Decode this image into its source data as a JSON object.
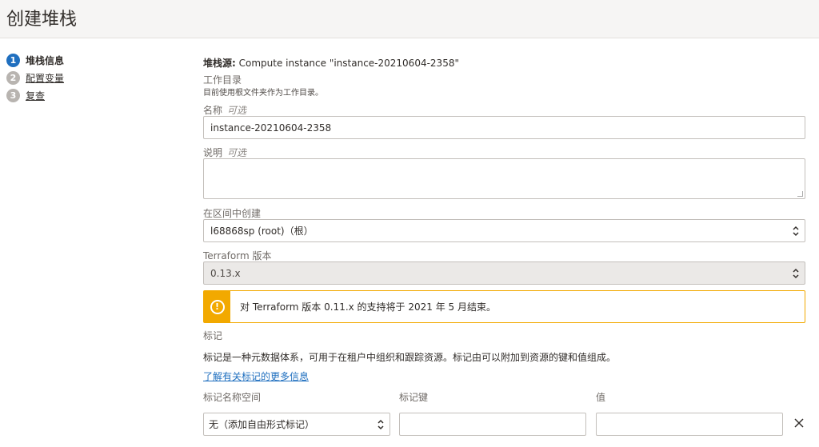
{
  "page": {
    "title": "创建堆栈"
  },
  "steps": [
    {
      "num": "1",
      "label": "堆栈信息",
      "active": true
    },
    {
      "num": "2",
      "label": "配置变量",
      "active": false
    },
    {
      "num": "3",
      "label": "复查",
      "active": false
    }
  ],
  "source": {
    "label": "堆栈源:",
    "value": "Compute instance \"instance-20210604-2358\""
  },
  "workdir": {
    "label": "工作目录",
    "hint": "目前使用根文件夹作为工作目录。"
  },
  "name_field": {
    "label": "名称",
    "optional": "可选",
    "value": "instance-20210604-2358"
  },
  "description_field": {
    "label": "说明",
    "optional": "可选",
    "value": ""
  },
  "compartment_field": {
    "label": "在区间中创建",
    "value": "l68868sp (root)（根）"
  },
  "terraform_field": {
    "label": "Terraform 版本",
    "value": "0.13.x"
  },
  "warning": {
    "icon": "exclamation-icon",
    "text": "对 Terraform 版本 0.11.x 的支持将于 2021 年 5 月结束。",
    "color": "#f2a900"
  },
  "tags": {
    "section_label": "标记",
    "description": "标记是一种元数据体系，可用于在租户中组织和跟踪资源。标记由可以附加到资源的键和值组成。",
    "learn_more": "了解有关标记的更多信息",
    "col_namespace": "标记名称空间",
    "col_key": "标记键",
    "col_value": "值",
    "namespace_value": "无（添加自由形式标记）",
    "key_value": "",
    "value_value": ""
  },
  "colors": {
    "accent": "#1f6fbf",
    "warning": "#f2a900"
  }
}
